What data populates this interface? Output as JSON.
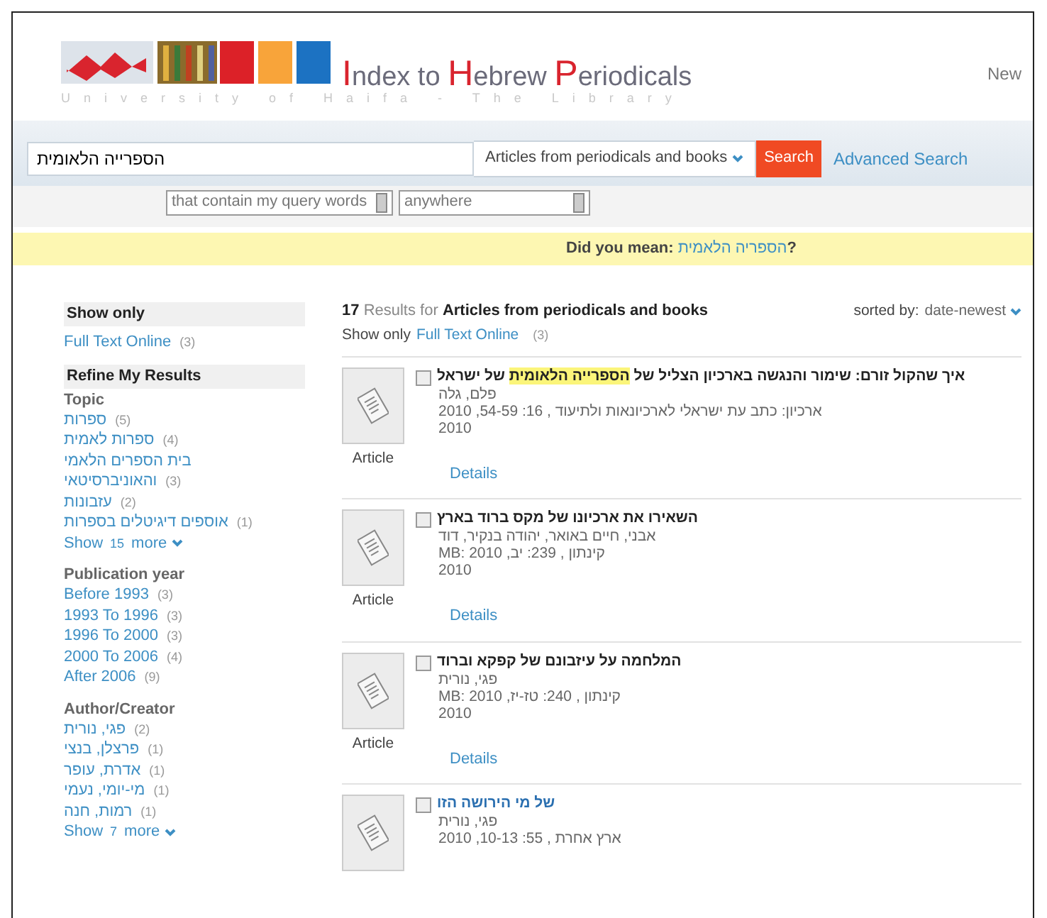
{
  "header": {
    "title": "**I**ndex to **H**ebrew **P**eriodicals",
    "subtitle": "University of Haifa - The Library",
    "top_link": "New"
  },
  "search": {
    "value": "הספרייה הלאומית",
    "scope": "Articles from periodicals and books",
    "button": "Search",
    "advanced": "Advanced Search",
    "match": "that contain my query words",
    "where": "anywhere"
  },
  "did_you_mean": {
    "label": "Did you mean:",
    "suggestion": "הספריה הלאמית",
    "suffix": "?"
  },
  "sidebar": {
    "show_only": {
      "heading": "Show only",
      "items": [
        {
          "label": "Full Text Online",
          "count": "(3)"
        }
      ]
    },
    "refine": {
      "heading": "Refine My Results",
      "facets": [
        {
          "heading": "Topic",
          "items": [
            {
              "label": "ספרות",
              "count": "(5)"
            },
            {
              "label": "ספרות לאמית",
              "count": "(4)"
            },
            {
              "label": "בית הספרים הלאמי"
            },
            {
              "label": "והאוניברסיטאי",
              "count": "(3)"
            },
            {
              "label": "עזבונות",
              "count": "(2)"
            },
            {
              "label": "אוספים דיגיטלים בספרות",
              "count": "(1)"
            }
          ],
          "show_more": {
            "label": "Show",
            "count": "15",
            "suffix": "more"
          }
        },
        {
          "heading": "Publication year",
          "items": [
            {
              "label": "Before 1993",
              "count": "(3)"
            },
            {
              "label": "1993 To 1996",
              "count": "(3)"
            },
            {
              "label": "1996 To 2000",
              "count": "(3)"
            },
            {
              "label": "2000 To 2006",
              "count": "(4)"
            },
            {
              "label": "After 2006",
              "count": "(9)"
            }
          ]
        },
        {
          "heading": "Author/Creator",
          "items": [
            {
              "label": "פגי, נורית",
              "count": "(2)"
            },
            {
              "label": "פרצלן, בנצי",
              "count": "(1)"
            },
            {
              "label": "אדרת, עופר",
              "count": "(1)"
            },
            {
              "label": "מי-יומי, נעמי",
              "count": "(1)"
            },
            {
              "label": "רמות, חנה",
              "count": "(1)"
            }
          ],
          "show_more": {
            "label": "Show",
            "count": "7",
            "suffix": "more"
          }
        }
      ]
    }
  },
  "results": {
    "count": "17",
    "results_for": "Results for",
    "collection": "Articles from periodicals and books",
    "sorted_label": "sorted by:",
    "sort": "date-newest",
    "show_only": "Show only",
    "filter": "Full Text Online",
    "filter_count": "(3)",
    "items": [
      {
        "type": "Article",
        "checked": false,
        "linked": false,
        "title": "איך שהקול זורם: שימור והנגשה בארכיון הצליל של **הספרייה הלאומית** של ישראל",
        "lines": [
          "פלם, גלה",
          "ארכיון: כתב עת ישראלי לארכיונאות ולתיעוד , 16: 54-59, 2010",
          "2010"
        ],
        "details": "Details"
      },
      {
        "type": "Article",
        "checked": false,
        "linked": false,
        "title": "השאירו את ארכיונו של מקס ברוד בארץ",
        "lines": [
          "אבני, חיים באואר, יהודה בנקיר, דוד",
          "קינתון , 239: יב, MB: 2010",
          "2010"
        ],
        "details": "Details"
      },
      {
        "type": "Article",
        "checked": false,
        "linked": false,
        "title": "המלחמה על עיזבונם של קפקא וברוד",
        "lines": [
          "פגי, נורית",
          "קינתון , 240: טז-יז, MB: 2010",
          "2010"
        ],
        "details": "Details"
      },
      {
        "checked": false,
        "linked": true,
        "title": "של מי הירושה הזו",
        "lines": [
          "פגי, נורית",
          "ארץ אחרת , 55: 10-13, 2010"
        ]
      }
    ]
  }
}
